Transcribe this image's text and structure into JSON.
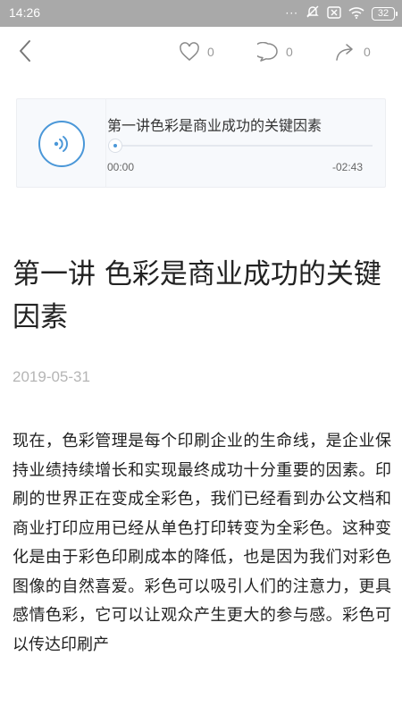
{
  "status_bar": {
    "time": "14:26",
    "battery": "32",
    "icons": [
      "more-dots-icon",
      "alarm-off-icon",
      "sim-none-icon",
      "wifi-icon",
      "battery-icon"
    ]
  },
  "nav": {
    "like_count": "0",
    "comment_count": "0",
    "share_count": "0"
  },
  "audio": {
    "title": "第一讲色彩是商业成功的关键因素",
    "elapsed": "00:00",
    "remaining": "-02:43",
    "progress": 0
  },
  "article": {
    "title": "第一讲 色彩是商业成功的关键因素",
    "date": "2019-05-31",
    "body": "现在，色彩管理是每个印刷企业的生命线，是企业保持业绩持续增长和实现最终成功十分重要的因素。印刷的世界正在变成全彩色，我们已经看到办公文档和商业打印应用已经从单色打印转变为全彩色。这种变化是由于彩色印刷成本的降低，也是因为我们对彩色图像的自然喜爱。彩色可以吸引人们的注意力，更具感情色彩，它可以让观众产生更大的参与感。彩色可以传达印刷产"
  },
  "colors": {
    "status_bar": "#a9a9a9",
    "accent": "#4a97d8",
    "icon_gray": "#8a8a8a",
    "date_gray": "#b5b5b5"
  }
}
